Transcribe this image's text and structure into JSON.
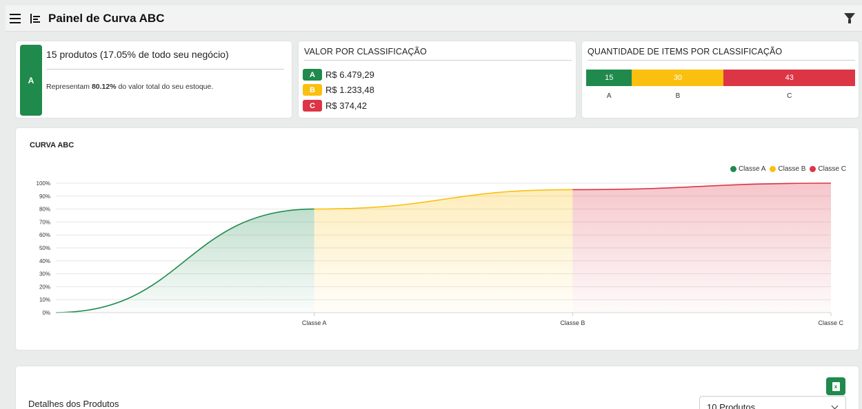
{
  "header": {
    "title": "Painel de Curva ABC",
    "menu_icon": "hamburger-icon",
    "dashboard_icon": "list-chart-icon",
    "filter_icon": "filter-icon"
  },
  "summary": {
    "badge": "A",
    "title": "15 produtos (17.05% de todo seu negócio)",
    "desc_prefix": "Representam ",
    "desc_bold": "80.12%",
    "desc_suffix": " do valor total do seu estoque."
  },
  "value_card": {
    "heading": "VALOR POR CLASSIFICAÇÃO",
    "rows": [
      {
        "badge": "A",
        "value": "R$ 6.479,29",
        "color": "#1f8a4c"
      },
      {
        "badge": "B",
        "value": "R$ 1.233,48",
        "color": "#fbbf0f"
      },
      {
        "badge": "C",
        "value": "R$ 374,42",
        "color": "#dc3545"
      }
    ]
  },
  "qty_card": {
    "heading": "QUANTIDADE DE ITEMS POR CLASSIFICAÇÃO",
    "segments": [
      {
        "count": "15",
        "label": "A",
        "value": 15,
        "color": "#1f8a4c"
      },
      {
        "count": "30",
        "label": "B",
        "value": 30,
        "color": "#fbbf0f"
      },
      {
        "count": "43",
        "label": "C",
        "value": 43,
        "color": "#dc3545"
      }
    ]
  },
  "chart_card": {
    "title": "CURVA ABC"
  },
  "chart_data": {
    "type": "area",
    "title": "CURVA ABC",
    "categories": [
      "",
      "Classe A",
      "Classe B",
      "Classe C"
    ],
    "ylim": [
      0,
      100
    ],
    "yticks": [
      "0%",
      "10%",
      "20%",
      "30%",
      "40%",
      "50%",
      "60%",
      "70%",
      "80%",
      "90%",
      "100%"
    ],
    "grid": true,
    "legend_position": "top-right",
    "series": [
      {
        "name": "Classe A",
        "color": "#1f8a4c",
        "points": [
          [
            0,
            0
          ],
          [
            1,
            80
          ]
        ]
      },
      {
        "name": "Classe B",
        "color": "#fbbf0f",
        "points": [
          [
            1,
            80
          ],
          [
            2,
            95
          ]
        ]
      },
      {
        "name": "Classe C",
        "color": "#dc3545",
        "points": [
          [
            2,
            95
          ],
          [
            3,
            100
          ]
        ]
      }
    ]
  },
  "details": {
    "title": "Detalhes dos Produtos",
    "select_value": "10 Produtos",
    "excel_icon": "excel-export-icon",
    "excel_glyph": "x"
  }
}
